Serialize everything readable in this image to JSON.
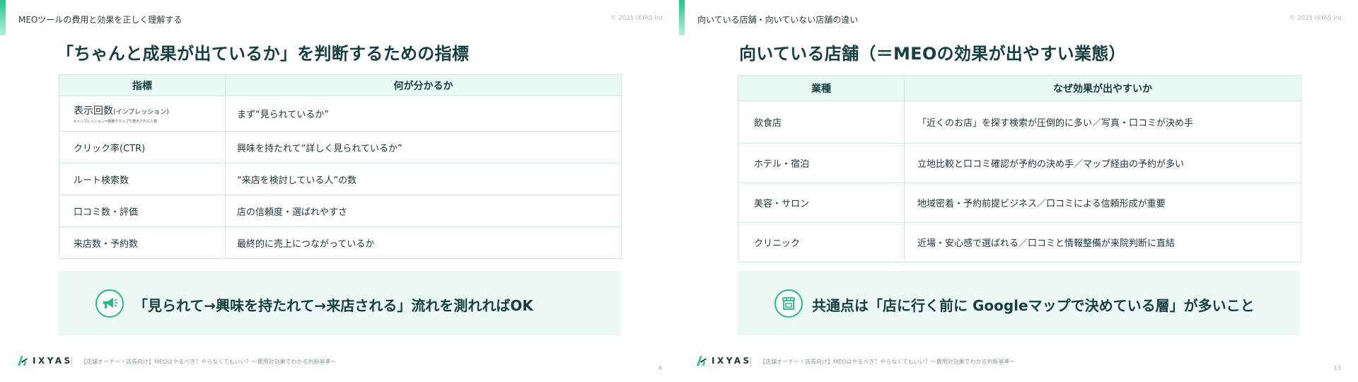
{
  "slides": [
    {
      "header": "MEOツールの費用と効果を正しく理解する",
      "copyright": "© 2025 IXYAS Inc",
      "title": "「ちゃんと成果が出ているか」を判断するための指標",
      "table": {
        "headers": [
          "指標",
          "何が分かるか"
        ],
        "rows": [
          {
            "main": "表示回数",
            "sub": "(インプレッション)",
            "note": "※インプレッション=検索やマップで表示された人数",
            "value": "まず“見られているか”"
          },
          {
            "main": "クリック率(CTR)",
            "value": "興味を持たれて“詳しく見られているか”"
          },
          {
            "main": "ルート検索数",
            "value": "“来店を検討している人”の数"
          },
          {
            "main": "口コミ数・評価",
            "value": "店の信頼度・選ばれやすさ"
          },
          {
            "main": "来店数・予約数",
            "value": " 最終的に売上につながっているか"
          }
        ]
      },
      "callout": {
        "icon": "megaphone-icon",
        "text": "「見られて→興味を持たれて→来店される」流れを測れればOK"
      },
      "footer": {
        "logo": "IXYAS",
        "text": "【店舗オーナー・店長向け】MEOはやるべき？やらなくてもいい？〜費用対効果でわかる判断基準〜",
        "page": "8"
      }
    },
    {
      "header": "向いている店舗・向いていない店舗の違い",
      "copyright": "© 2025 IXYAS Inc",
      "title": "向いている店舗（＝MEOの効果が出やすい業態）",
      "table": {
        "headers": [
          "業種",
          "なぜ効果が出やすいか"
        ],
        "rows": [
          {
            "main": "飲食店",
            "value": "「近くのお店」を探す検索が圧倒的に多い／写真・口コミが決め手"
          },
          {
            "main": "ホテル・宿泊",
            "value": "立地比較と口コミ確認が予約の決め手／マップ経由の予約が多い"
          },
          {
            "main": "美容・サロン",
            "value": "地域密着・予約前提ビジネス／口コミによる信頼形成が重要"
          },
          {
            "main": "クリニック",
            "value": " 近場・安心感で選ばれる／口コミと情報整備が来院判断に直結"
          }
        ]
      },
      "callout": {
        "icon": "store-icon",
        "text": "共通点は「店に行く前に Googleマップで決めている層」が多いこと"
      },
      "footer": {
        "logo": "IXYAS",
        "text": "【店舗オーナー・店長向け】MEOはやるべき？やらなくてもいい？〜費用対効果でわかる判断基準〜",
        "page": "13"
      }
    }
  ],
  "colors": {
    "accent": "#27b88a",
    "header_bg": "#e8faf3",
    "callout_bg": "#ebf8f4",
    "title": "#173f3f"
  }
}
